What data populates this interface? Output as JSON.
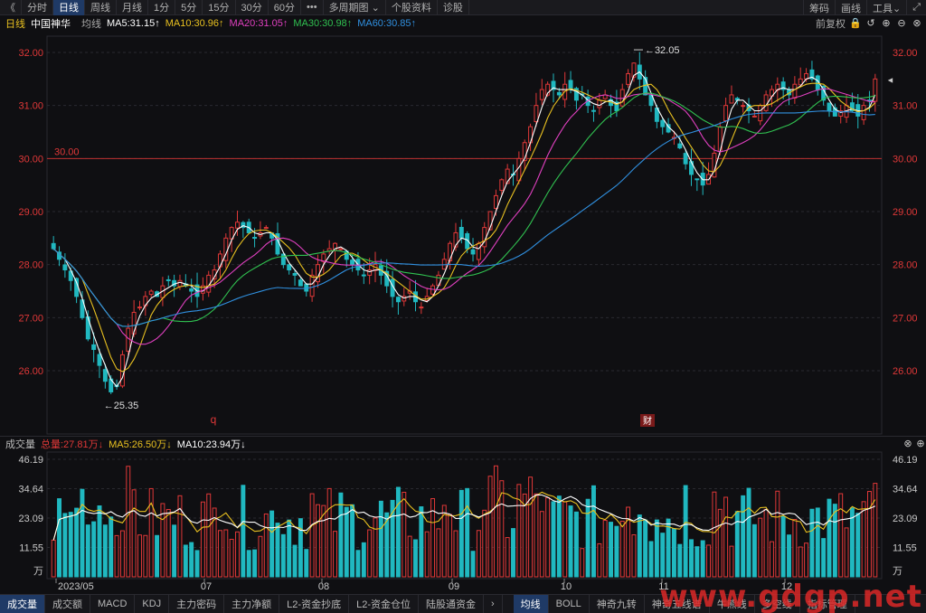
{
  "toolbar": {
    "back": "《",
    "tabs": [
      "分时",
      "日线",
      "周线",
      "月线",
      "1分",
      "5分",
      "15分",
      "30分",
      "60分",
      "•••",
      "多周期图 ⌄",
      "个股资料",
      "诊股"
    ],
    "active_tab": "日线",
    "right": [
      "筹码",
      "画线",
      "工具⌄"
    ],
    "fullscreen_icon": "expand-icon"
  },
  "info": {
    "period": "日线",
    "name": "中国神华",
    "avg": "均线",
    "ma5": "MA5:31.15↑",
    "ma10": "MA10:30.96↑",
    "ma20": "MA20:31.05↑",
    "ma30": "MA30:30.98↑",
    "ma60": "MA60:30.85↑",
    "adjust": "前复权"
  },
  "colors": {
    "up": "#e03838",
    "down": "#20b8c0",
    "ma5": "#ffffff",
    "ma10": "#e8c020",
    "ma20": "#e040c0",
    "ma30": "#30c050",
    "ma60": "#3090e0",
    "grid": "#2a2a30",
    "refline": "#c03030"
  },
  "price_axis": [
    "32.00",
    "31.00",
    "30.00",
    "29.00",
    "28.00",
    "27.00",
    "26.00"
  ],
  "price_ref": "30.00",
  "annotations": {
    "high": "32.05",
    "low": "25.35",
    "marker_q": "q",
    "marker_cai": "财"
  },
  "volume": {
    "title": "成交量",
    "total": "总量:27.81万↓",
    "ma5": "MA5:26.50万↓",
    "ma10": "MA10:23.94万↓",
    "axis": [
      "46.19",
      "34.64",
      "23.09",
      "11.55",
      "万"
    ]
  },
  "x_axis": [
    "2023/05",
    "07",
    "08",
    "09",
    "10",
    "11",
    "12"
  ],
  "bottom_tabs_left": [
    "成交量",
    "成交额",
    "MACD",
    "KDJ",
    "主力密码",
    "主力净额",
    "L2-资金抄底",
    "L2-资金仓位",
    "陆股通资金"
  ],
  "bottom_tabs_right": [
    "均线",
    "BOLL",
    "神奇九转",
    "神奇五线谱",
    "牛熊线",
    "多空线",
    "指标管理"
  ],
  "active_bottom_left": "成交量",
  "active_bottom_right": "均线",
  "watermark": "www.gdgp.net",
  "chart_data": {
    "type": "candlestick",
    "ylim": [
      25.2,
      32.3
    ],
    "closes": [
      28.3,
      28.1,
      27.9,
      27.7,
      27.4,
      27.0,
      26.6,
      26.4,
      26.1,
      25.8,
      25.6,
      25.7,
      26.3,
      26.8,
      27.1,
      27.2,
      27.4,
      27.5,
      27.4,
      27.6,
      27.7,
      27.6,
      27.7,
      27.6,
      27.5,
      27.4,
      27.6,
      27.8,
      27.9,
      28.2,
      28.5,
      28.7,
      28.8,
      28.7,
      28.6,
      28.5,
      28.6,
      28.7,
      28.5,
      28.2,
      28.0,
      27.9,
      27.8,
      27.6,
      27.5,
      27.8,
      28.0,
      28.2,
      28.3,
      28.4,
      28.3,
      28.1,
      28.0,
      27.9,
      27.8,
      27.9,
      28.0,
      27.8,
      27.6,
      27.4,
      27.3,
      27.4,
      27.5,
      27.3,
      27.2,
      27.4,
      27.6,
      27.8,
      28.1,
      28.4,
      28.6,
      28.5,
      28.3,
      28.2,
      28.4,
      28.7,
      29.0,
      29.3,
      29.6,
      29.8,
      29.7,
      30.0,
      30.3,
      30.6,
      31.0,
      31.3,
      31.4,
      31.3,
      31.2,
      31.4,
      31.3,
      31.1,
      31.2,
      31.0,
      30.9,
      31.1,
      31.2,
      31.0,
      30.9,
      31.3,
      31.6,
      31.8,
      31.5,
      31.2,
      31.0,
      30.7,
      30.6,
      30.5,
      30.4,
      30.2,
      29.9,
      29.7,
      29.6,
      29.5,
      29.7,
      30.1,
      30.6,
      31.0,
      31.2,
      31.1,
      31.0,
      30.9,
      30.8,
      31.0,
      31.2,
      31.3,
      31.4,
      31.3,
      31.2,
      31.4,
      31.5,
      31.6,
      31.5,
      31.3,
      31.1,
      30.9,
      30.8,
      30.9,
      31.0,
      30.9,
      30.8,
      31.0,
      31.1,
      31.5
    ],
    "ma_values": {
      "MA5": 31.15,
      "MA10": 30.96,
      "MA20": 31.05,
      "MA30": 30.98,
      "MA60": 30.85
    }
  }
}
